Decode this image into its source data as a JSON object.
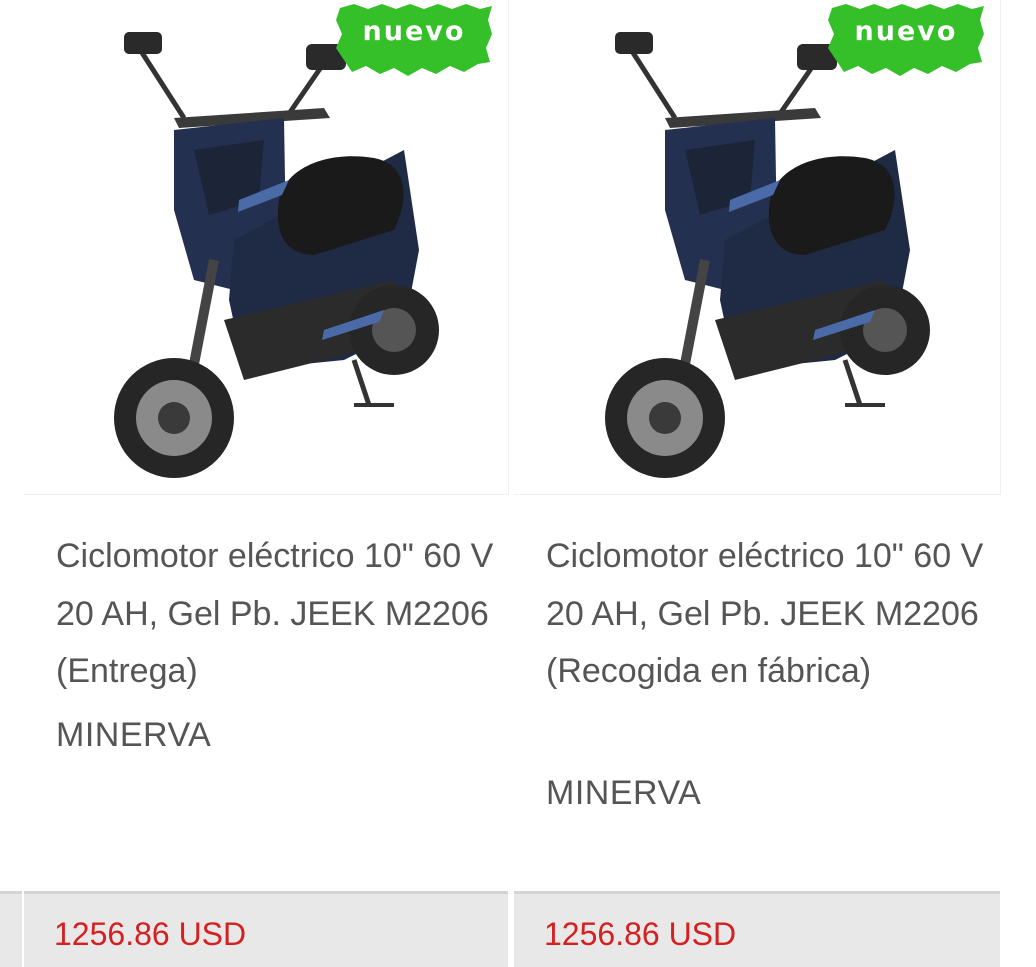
{
  "products": [
    {
      "badge": "nuevo",
      "title": "Ciclomotor eléctrico 10\" 60 V 20 AH, Gel Pb. JEEK M2206 (Entrega)",
      "brand": "MINERVA",
      "price": "1256.86 USD"
    },
    {
      "badge": "nuevo",
      "title": "Ciclomotor eléctrico 10\" 60 V 20 AH, Gel Pb. JEEK M2206 (Recogida en fábrica)",
      "brand": "MINERVA",
      "price": "1256.86 USD"
    }
  ],
  "colors": {
    "badge_green": "#35c02a",
    "price_red": "#d42020",
    "price_bar_bg": "#e8e8e8",
    "text_gray": "#555555"
  }
}
